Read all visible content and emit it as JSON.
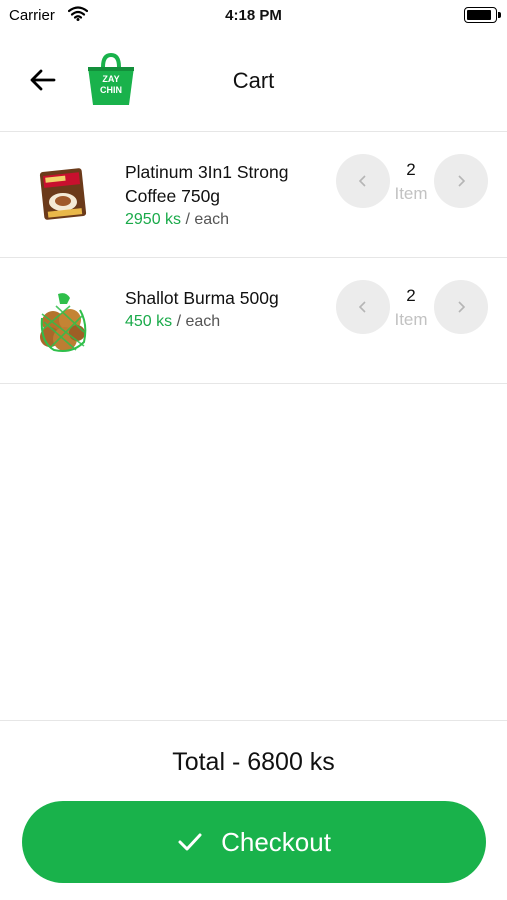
{
  "status_bar": {
    "carrier": "Carrier",
    "time": "4:18 PM"
  },
  "header": {
    "title": "Cart",
    "back_icon": "arrow-left-icon",
    "logo_text_line1": "ZAY",
    "logo_text_line2": "CHIN"
  },
  "cart": {
    "items": [
      {
        "name_line1": "Platinum 3In1  Strong",
        "name_line2": "Coffee 750g",
        "price": "2950 ks",
        "price_suffix": " / each",
        "quantity": "2",
        "unit": "Item"
      },
      {
        "name_line1": "Shallot Burma 500g",
        "name_line2": "",
        "price": "450 ks",
        "price_suffix": " / each",
        "quantity": "2",
        "unit": "Item"
      }
    ]
  },
  "footer": {
    "total": "Total - 6800 ks",
    "checkout_label": "Checkout",
    "checkout_icon": "checkmark-icon"
  },
  "colors": {
    "accent": "#19b24b",
    "price": "#1aaa4a",
    "qty_button": "#ececec"
  }
}
